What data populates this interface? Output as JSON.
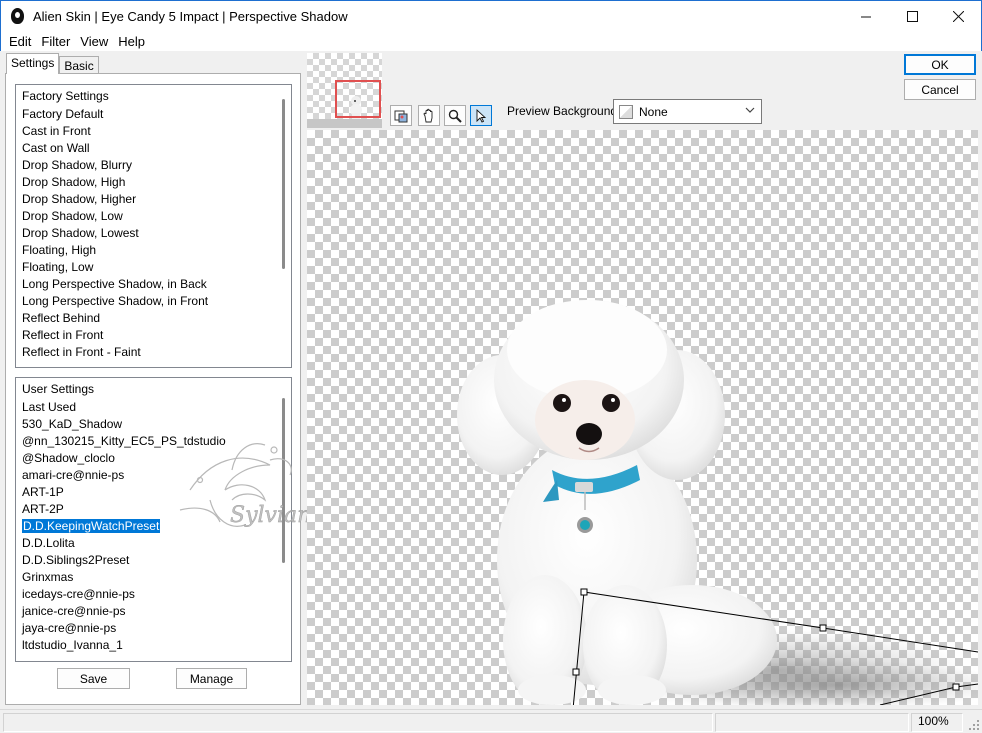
{
  "window": {
    "title": "Alien Skin | Eye Candy 5 Impact | Perspective Shadow",
    "min_icon": "minimize-icon",
    "max_icon": "maximize-icon",
    "close_icon": "close-icon"
  },
  "menu": [
    {
      "label": "Edit",
      "mnemonic": "E"
    },
    {
      "label": "Filter",
      "mnemonic": "F"
    },
    {
      "label": "View",
      "mnemonic": "V"
    },
    {
      "label": "Help",
      "mnemonic": "H"
    }
  ],
  "tabs": [
    "Settings",
    "Basic"
  ],
  "factory": {
    "header": "Factory Settings",
    "items": [
      "Factory Default",
      "Cast in Front",
      "Cast on Wall",
      "Drop Shadow, Blurry",
      "Drop Shadow, High",
      "Drop Shadow, Higher",
      "Drop Shadow, Low",
      "Drop Shadow, Lowest",
      "Floating, High",
      "Floating, Low",
      "Long Perspective Shadow, in Back",
      "Long Perspective Shadow, in Front",
      "Reflect Behind",
      "Reflect in Front",
      "Reflect in Front - Faint"
    ]
  },
  "user": {
    "header": "User Settings",
    "selected_index": 7,
    "items": [
      "Last Used",
      "530_KaD_Shadow",
      "@nn_130215_Kitty_EC5_PS_tdstudio",
      "@Shadow_cloclo",
      "amari-cre@nnie-ps",
      "ART-1P",
      "ART-2P",
      "D.D.KeepingWatchPreset",
      "D.D.Lolita",
      "D.D.Siblings2Preset",
      "Grinxmas",
      "icedays-cre@nnie-ps",
      "janice-cre@nnie-ps",
      "jaya-cre@nnie-ps",
      "ltdstudio_Ivanna_1"
    ]
  },
  "buttons": {
    "save": "Save",
    "manage": "Manage",
    "ok": "OK",
    "cancel": "Cancel"
  },
  "preview": {
    "background_label": "Preview Background:",
    "background_value": "None",
    "tools": [
      "navigator-icon",
      "hand-icon",
      "zoom-icon",
      "pointer-icon"
    ],
    "active_tool": "pointer-icon"
  },
  "watermark": "Sylviane",
  "status": {
    "zoom": "100%"
  },
  "colors": {
    "accent": "#0078d7",
    "selection": "#0078d7",
    "title_border": "#1e6fd0"
  }
}
